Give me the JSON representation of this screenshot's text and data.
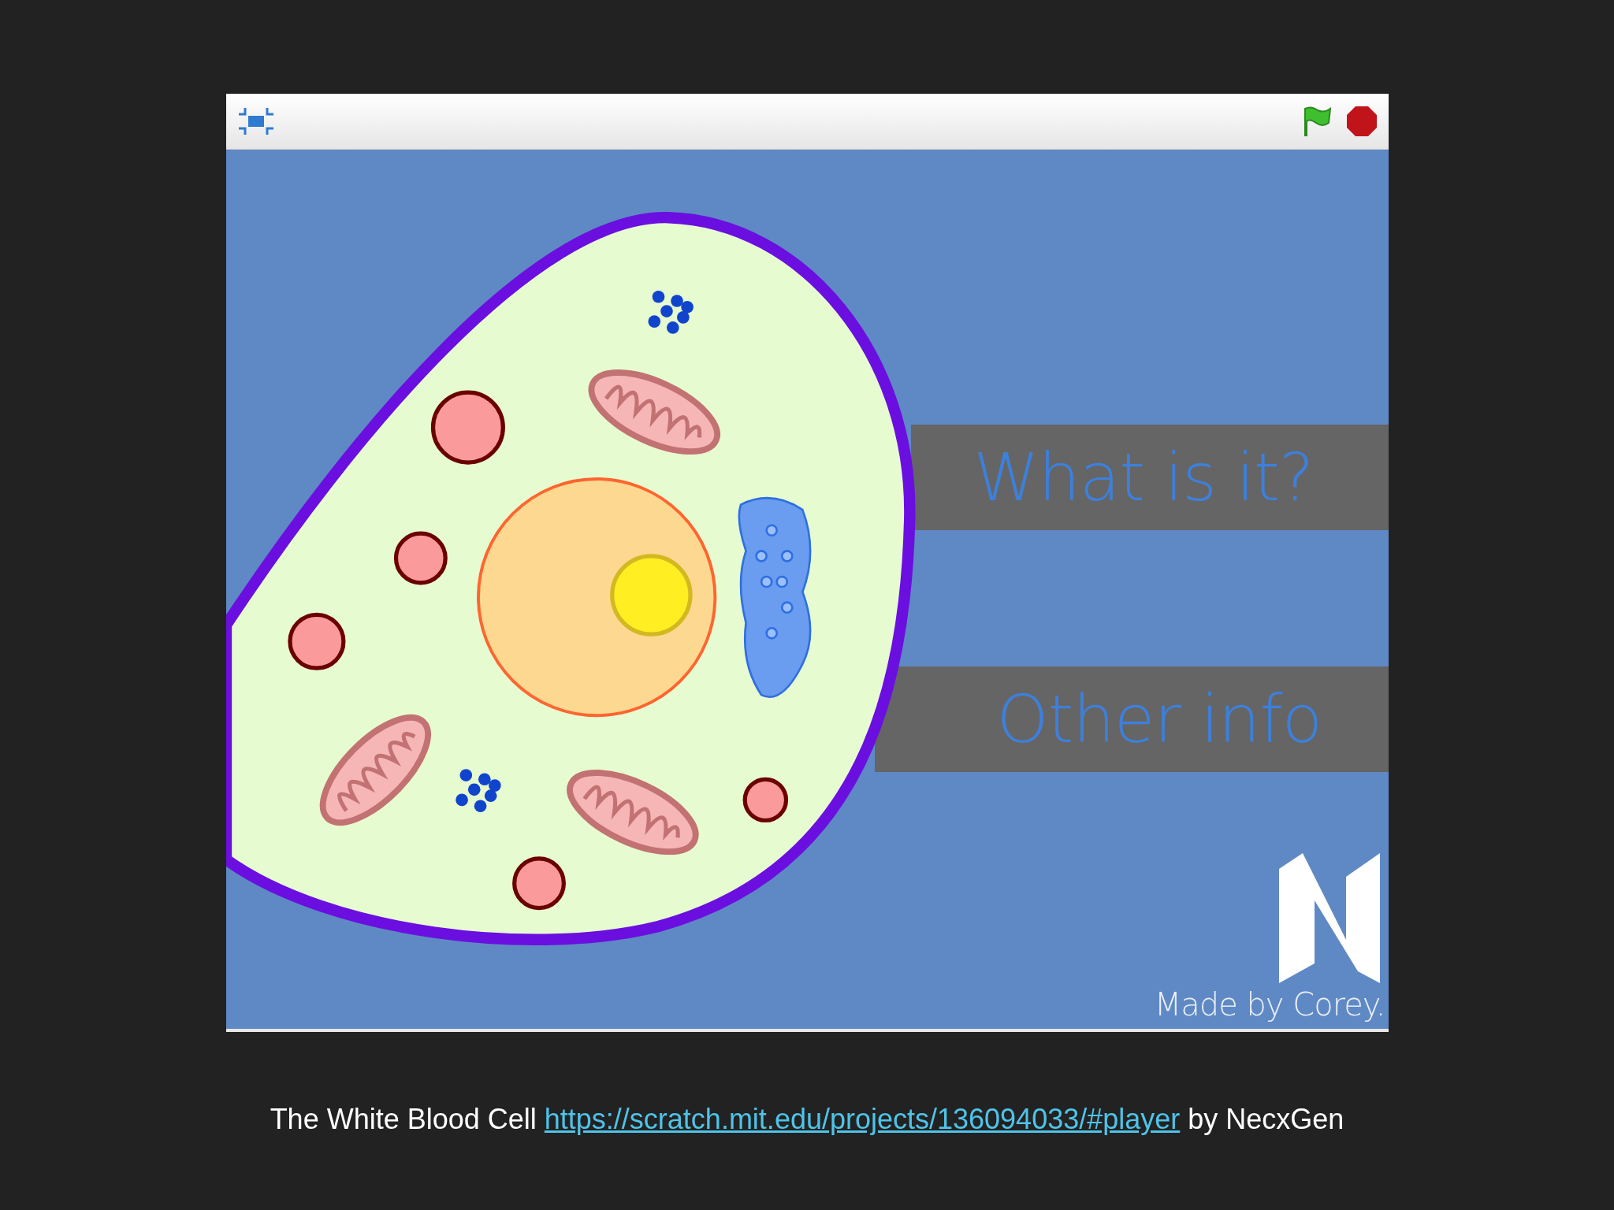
{
  "player": {
    "stage": {
      "buttons": [
        {
          "label": "What is it?"
        },
        {
          "label": "Other info"
        }
      ],
      "credit": "Made by Corey."
    }
  },
  "caption": {
    "title": "The White Blood Cell",
    "link": "https://scratch.mit.edu/projects/136094033/#player",
    "author": "by NecxGen"
  }
}
